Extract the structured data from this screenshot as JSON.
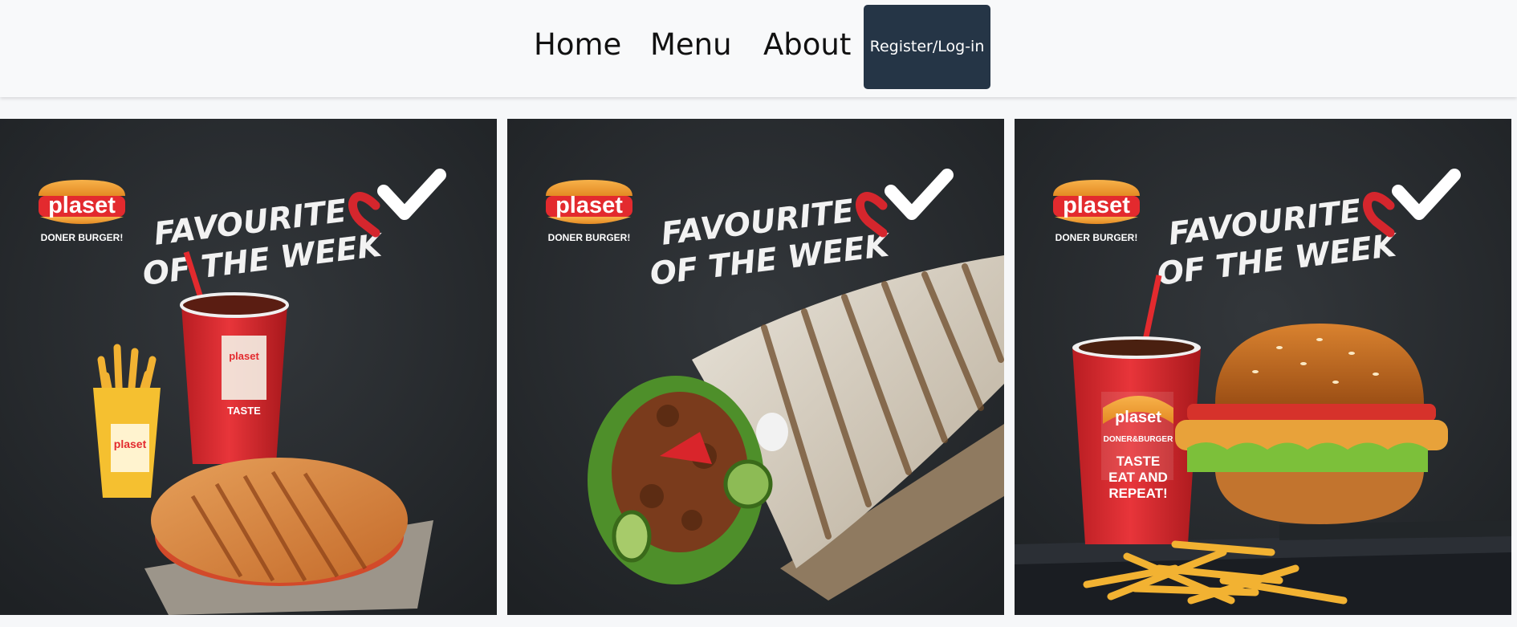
{
  "navbar": {
    "home_label": "Home",
    "menu_label": "Menu",
    "about_label": "About",
    "register_label": "Register/Log-in"
  },
  "promo": {
    "brand": "plaset",
    "tagline": "DONER BURGER!",
    "headline_line1": "FAVOURITE",
    "headline_line2": "OF THE WEEK",
    "cup_brand": "plaset",
    "cup_sub": "DONER&BURGER",
    "cup_slogan": [
      "TASTE",
      "EAT AND",
      "REPEAT!"
    ]
  },
  "cards": [
    {
      "product": "combo-meal"
    },
    {
      "product": "doner-wrap"
    },
    {
      "product": "chicken-burger"
    }
  ],
  "colors": {
    "nav_bg": "#f8f9fa",
    "button_bg": "#253546",
    "card_bg": "#25282b",
    "brand_red": "#e32a2e",
    "brand_orange": "#f3a33a",
    "heart_red": "#d5262d"
  }
}
